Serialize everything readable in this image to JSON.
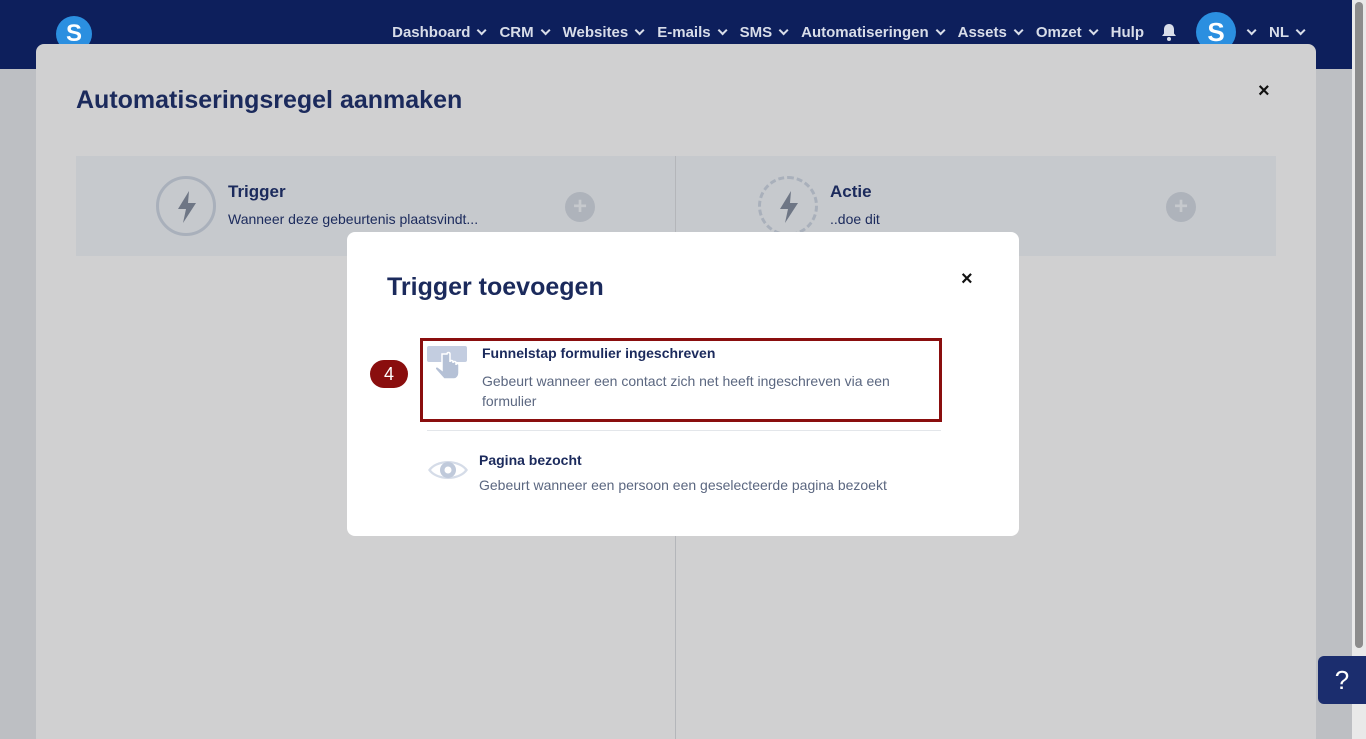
{
  "nav": {
    "logo_letter": "S",
    "items": [
      {
        "label": "Dashboard"
      },
      {
        "label": "CRM"
      },
      {
        "label": "Websites"
      },
      {
        "label": "E-mails"
      },
      {
        "label": "SMS"
      },
      {
        "label": "Automatiseringen"
      },
      {
        "label": "Assets"
      },
      {
        "label": "Omzet"
      }
    ],
    "help_label": "Hulp",
    "avatar_letter": "S",
    "language": "NL"
  },
  "outer_modal": {
    "title": "Automatiseringsregel aanmaken",
    "close_glyph": "×",
    "trigger_panel": {
      "title": "Trigger",
      "subtitle": "Wanneer deze gebeurtenis plaatsvindt..."
    },
    "action_panel": {
      "title": "Actie",
      "subtitle": "..doe dit"
    },
    "plus_glyph": "+"
  },
  "inner_modal": {
    "title": "Trigger toevoegen",
    "close_glyph": "×",
    "step_badge": "4",
    "options": [
      {
        "title": "Funnelstap formulier ingeschreven",
        "description": "Gebeurt wanneer een contact zich net heeft ingeschreven via een formulier",
        "icon": "hand-pointer-icon"
      },
      {
        "title": "Pagina bezocht",
        "description": "Gebeurt wanneer een persoon een geselecteerde pagina bezoekt",
        "icon": "eye-icon"
      }
    ]
  },
  "help_button": {
    "label": "?"
  },
  "colors": {
    "nav_bg": "#0d1f5c",
    "brand_blue": "#2b8fe0",
    "highlight": "#8a0e0e",
    "title_navy": "#1b2a5c"
  }
}
